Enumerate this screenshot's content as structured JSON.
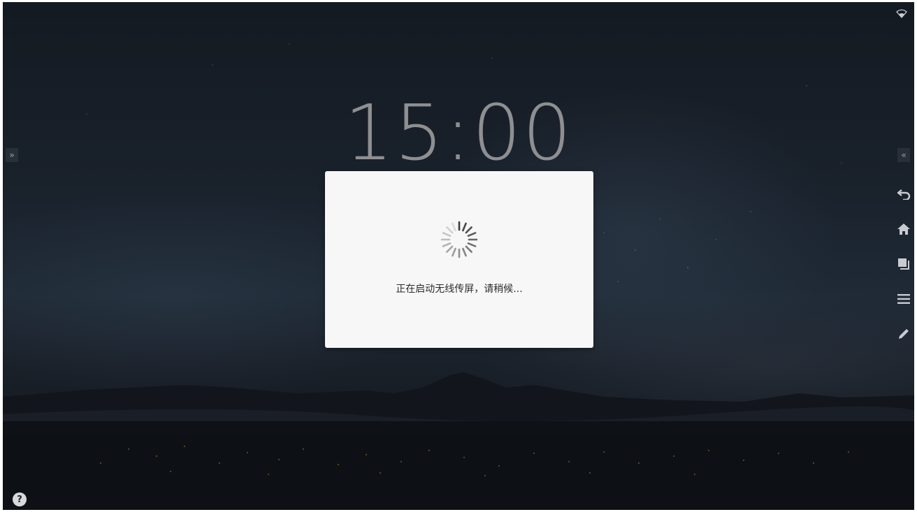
{
  "lockscreen": {
    "clock_time": "15:00"
  },
  "dialog": {
    "message": "正在启动无线传屏，请稍候..."
  },
  "sidebar_left": {
    "expand_glyph": "»"
  },
  "sidebar_right": {
    "collapse_glyph": "«",
    "tools": [
      {
        "icon": "back-icon"
      },
      {
        "icon": "home-icon"
      },
      {
        "icon": "windows-icon"
      },
      {
        "icon": "menu-icon"
      },
      {
        "icon": "pen-icon"
      }
    ]
  },
  "status_bar": {
    "wifi_icon": "wifi-icon"
  },
  "help": {
    "glyph": "?"
  },
  "colors": {
    "dialog_bg": "#f7f7f7",
    "clock": "#8e8f92",
    "icon": "#c8ccd2"
  }
}
